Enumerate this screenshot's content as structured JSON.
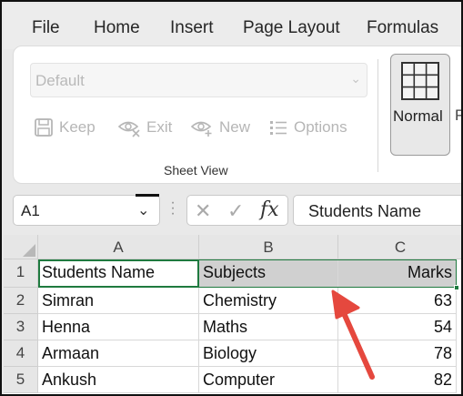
{
  "menu": {
    "tabs": [
      "File",
      "Home",
      "Insert",
      "Page Layout",
      "Formulas"
    ]
  },
  "ribbon": {
    "sheet_view_dropdown": "Default",
    "buttons": {
      "keep": "Keep",
      "exit": "Exit",
      "new": "New",
      "options": "Options"
    },
    "group_label": "Sheet View",
    "normal_label": "Normal",
    "next_cut": "P"
  },
  "formula_bar": {
    "name_box": "A1",
    "formula": "Students Name",
    "fx": "fx"
  },
  "grid": {
    "columns": [
      "A",
      "B",
      "C"
    ],
    "rows": [
      {
        "num": "1",
        "a": "Students Name",
        "b": "Subjects",
        "c": "Marks"
      },
      {
        "num": "2",
        "a": "Simran",
        "b": "Chemistry",
        "c": "63"
      },
      {
        "num": "3",
        "a": "Henna",
        "b": "Maths",
        "c": "54"
      },
      {
        "num": "4",
        "a": "Armaan",
        "b": "Biology",
        "c": "78"
      },
      {
        "num": "5",
        "a": "Ankush",
        "b": "Computer",
        "c": "82"
      }
    ]
  },
  "colors": {
    "accent_green": "#1f7a3f",
    "arrow_red": "#e5483e"
  }
}
